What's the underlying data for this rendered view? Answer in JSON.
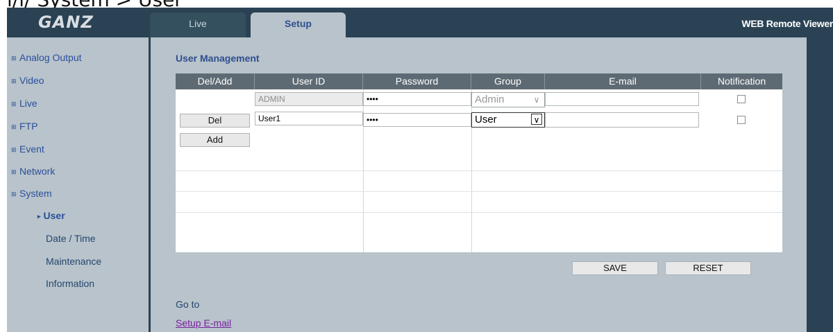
{
  "page_heading": "ı/ı/ System > User",
  "header": {
    "logo": "GANZ",
    "tabs": [
      {
        "label": "Live"
      },
      {
        "label": "Setup"
      }
    ],
    "viewer_title": "WEB Remote Viewer"
  },
  "sidebar": {
    "items": [
      {
        "label": "Analog Output"
      },
      {
        "label": "Video"
      },
      {
        "label": "Live"
      },
      {
        "label": "FTP"
      },
      {
        "label": "Event"
      },
      {
        "label": "Network"
      },
      {
        "label": "System"
      }
    ],
    "sub_items": [
      {
        "label": "User",
        "active": true
      },
      {
        "label": "Date / Time"
      },
      {
        "label": "Maintenance"
      },
      {
        "label": "Information"
      }
    ]
  },
  "main": {
    "section_title": "User Management",
    "columns": [
      "Del/Add",
      "User ID",
      "Password",
      "Group",
      "E-mail",
      "Notification"
    ],
    "rows": [
      {
        "user_id": "ADMIN",
        "password": "••••",
        "group": "Admin",
        "email": "",
        "notify": false
      },
      {
        "del_label": "Del",
        "user_id": "User1",
        "password": "••••",
        "group": "User",
        "email": "",
        "notify": false
      }
    ],
    "add_label": "Add",
    "save_label": "SAVE",
    "reset_label": "RESET",
    "goto_label": "Go to",
    "goto_link": "Setup E-mail"
  }
}
